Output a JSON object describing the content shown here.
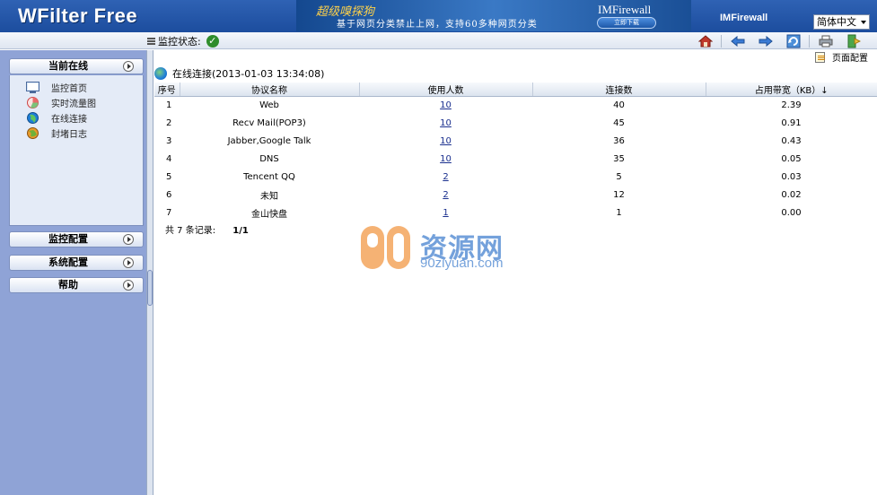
{
  "app": {
    "title": "WFilter Free",
    "brand_right": "IMFirewall",
    "language": "简体中文"
  },
  "banner": {
    "title": "超级嗅探狗",
    "subtitle": "基于网页分类禁止上网，支持60多种网页分类",
    "brand": "IMFirewall",
    "button": "立即下载"
  },
  "toolbar": {
    "status_label": "监控状态:",
    "icons": [
      "home-icon",
      "back-arrow-icon",
      "forward-arrow-icon",
      "refresh-icon",
      "print-icon",
      "exit-icon"
    ]
  },
  "sidebar": {
    "current_online": "当前在线",
    "items": [
      {
        "label": "监控首页",
        "icon": "monitor-icon"
      },
      {
        "label": "实时流量图",
        "icon": "pie-chart-icon"
      },
      {
        "label": "在线连接",
        "icon": "globe-icon"
      },
      {
        "label": "封堵日志",
        "icon": "block-log-icon"
      }
    ],
    "monitor_config": "监控配置",
    "system_config": "系统配置",
    "help": "帮助"
  },
  "main": {
    "page_config": "页面配置",
    "connection_title": "在线连接(2013-01-03 13:34:08)",
    "table": {
      "headers": [
        "序号",
        "协议名称",
        "使用人数",
        "连接数",
        "占用带宽（KB）↓"
      ],
      "rows": [
        [
          "1",
          "Web",
          "10",
          "40",
          "2.39"
        ],
        [
          "2",
          "Recv Mail(POP3)",
          "10",
          "45",
          "0.91"
        ],
        [
          "3",
          "Jabber,Google Talk",
          "10",
          "36",
          "0.43"
        ],
        [
          "4",
          "DNS",
          "10",
          "35",
          "0.05"
        ],
        [
          "5",
          "Tencent QQ",
          "2",
          "5",
          "0.03"
        ],
        [
          "6",
          "未知",
          "2",
          "12",
          "0.02"
        ],
        [
          "7",
          "金山快盘",
          "1",
          "1",
          "0.00"
        ]
      ]
    },
    "footer_label": "共 7 条记录:",
    "footer_page": "1/1"
  },
  "watermark": {
    "text": "资源网",
    "url": "90ziyuan.com"
  }
}
